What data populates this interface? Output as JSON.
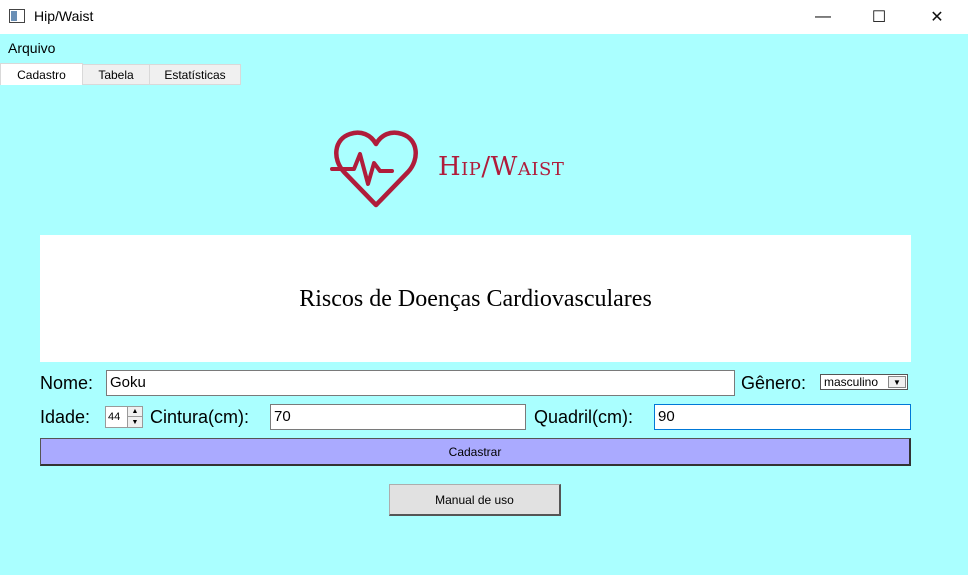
{
  "window": {
    "title": "Hip/Waist",
    "minimize_glyph": "—",
    "maximize_glyph": "☐",
    "close_glyph": "✕"
  },
  "menu": {
    "arquivo": "Arquivo"
  },
  "tabs": [
    {
      "label": "Cadastro",
      "active": true
    },
    {
      "label": "Tabela",
      "active": false
    },
    {
      "label": "Estatísticas",
      "active": false
    }
  ],
  "logo": {
    "icon": "heart-pulse-icon",
    "text": "Hip/Waist",
    "color": "#b01c3b"
  },
  "banner": {
    "title": "Riscos de Doenças Cardiovasculares"
  },
  "form": {
    "nome_label": "Nome:",
    "nome_value": "Goku",
    "genero_label": "Gênero:",
    "genero_value": "masculino",
    "idade_label": "Idade:",
    "idade_value": "44",
    "cintura_label": "Cintura(cm):",
    "cintura_value": "70",
    "quadril_label": "Quadril(cm):",
    "quadril_value": "90"
  },
  "buttons": {
    "cadastrar": "Cadastrar",
    "manual": "Manual de uso"
  },
  "colors": {
    "background": "#aaffff",
    "cadastrar_button": "#aaaaff"
  }
}
